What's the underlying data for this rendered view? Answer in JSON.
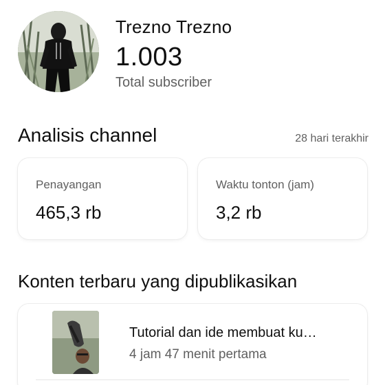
{
  "channel": {
    "name": "Trezno Trezno",
    "subscriber_count": "1.003",
    "subscriber_label": "Total subscriber",
    "avatar_icon": "channel-avatar"
  },
  "analytics": {
    "title": "Analisis channel",
    "period": "28 hari terakhir",
    "stats": [
      {
        "label": "Penayangan",
        "value": "465,3 rb"
      },
      {
        "label": "Waktu tonton (jam)",
        "value": "3,2 rb"
      }
    ]
  },
  "recent": {
    "title": "Konten terbaru yang dipublikasikan",
    "videos": [
      {
        "title": "Tutorial dan ide membuat ku…",
        "meta": "4 jam 47 menit pertama",
        "thumbnail_icon": "video-thumbnail"
      }
    ]
  }
}
